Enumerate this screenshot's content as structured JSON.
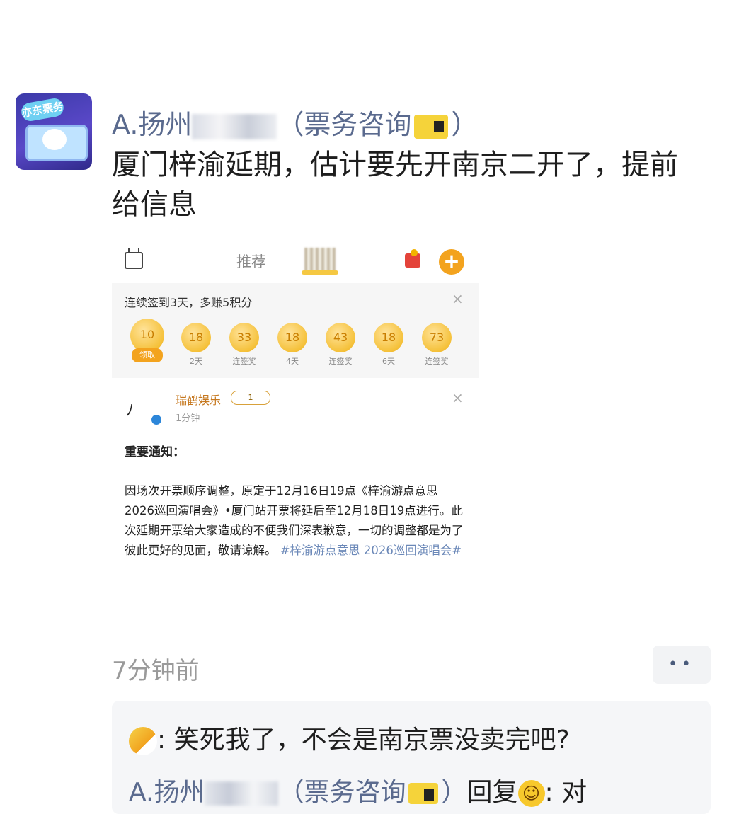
{
  "post": {
    "sender_prefix": "A.扬州",
    "sender_suffix": "（票务咨询",
    "sender_close": "）",
    "avatar_text": "亦东票务",
    "message": "厦门梓渝延期，估计要先开南京二开了，提前给信息",
    "timestamp": "7分钟前",
    "more_label": "••"
  },
  "screenshot": {
    "tab_recommend": "推荐",
    "plus_label": "+",
    "checkin": {
      "title": "连续签到3天，多赚5积分",
      "close": "×",
      "days": [
        {
          "value": "10",
          "label": "领取"
        },
        {
          "value": "18",
          "label": "2天"
        },
        {
          "value": "33",
          "label": "连签奖"
        },
        {
          "value": "18",
          "label": "4天"
        },
        {
          "value": "43",
          "label": "连签奖"
        },
        {
          "value": "18",
          "label": "6天"
        },
        {
          "value": "73",
          "label": "连签奖"
        }
      ]
    },
    "notice": {
      "account": "瑞鹤娱乐",
      "badge": "1",
      "time": "1分钟",
      "close": "×",
      "title": "重要通知：",
      "body": "因场次开票顺序调整，原定于12月16日19点《梓渝游点意思 2026巡回演唱会》•厦门站开票将延后至12月18日19点进行。此次延期开票给大家造成的不便我们深表歉意，一切的调整都是为了彼此更好的见面，敬请谅解。",
      "hashtag": "#梓渝游点意思 2026巡回演唱会#"
    }
  },
  "comments": [
    {
      "sep": ":",
      "text": " 笑死我了，不会是南京票没卖完吧?"
    },
    {
      "name_prefix": "A.扬州",
      "name_suffix": "（票务咨询",
      "name_close": "）",
      "reply_label": "回复",
      "sep": ":",
      "text": " 对"
    }
  ]
}
